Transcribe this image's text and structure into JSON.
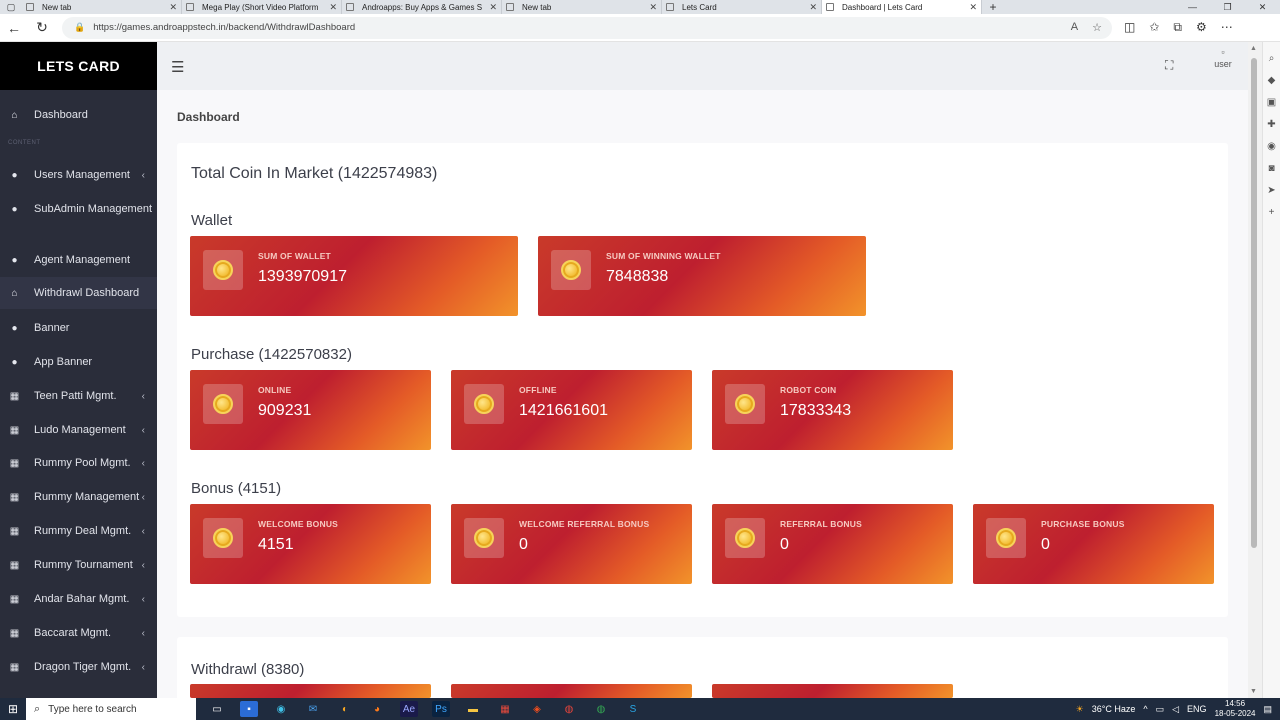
{
  "browser": {
    "tabs": [
      {
        "label": "New tab",
        "active": false
      },
      {
        "label": "Mega Play (Short Video Platform",
        "active": false
      },
      {
        "label": "Androapps: Buy Apps & Games S",
        "active": false
      },
      {
        "label": "New tab",
        "active": false
      },
      {
        "label": "Lets Card",
        "active": false
      },
      {
        "label": "Dashboard | Lets Card",
        "active": true
      }
    ],
    "url": "https://games.androappstech.in/backend/WithdrawlDashboard"
  },
  "sidebar": {
    "brand": "LETS CARD",
    "section_label": "CONTENT",
    "items": [
      {
        "label": "Dashboard",
        "icon": "home-icon",
        "has_chevron": false
      },
      {
        "label": "Users Management",
        "icon": "user-icon",
        "has_chevron": true
      },
      {
        "label": "SubAdmin Management",
        "icon": "user-icon",
        "has_chevron": false
      },
      {
        "label": "Agent Management",
        "icon": "user-icon",
        "has_chevron": false
      },
      {
        "label": "Withdrawl Dashboard",
        "icon": "home-icon",
        "has_chevron": false
      },
      {
        "label": "Banner",
        "icon": "user-icon",
        "has_chevron": false
      },
      {
        "label": "App Banner",
        "icon": "user-icon",
        "has_chevron": false
      },
      {
        "label": "Teen Patti Mgmt.",
        "icon": "grid-icon",
        "has_chevron": true
      },
      {
        "label": "Ludo Management",
        "icon": "grid-icon",
        "has_chevron": true
      },
      {
        "label": "Rummy Pool Mgmt.",
        "icon": "grid-icon",
        "has_chevron": true
      },
      {
        "label": "Rummy Management",
        "icon": "grid-icon",
        "has_chevron": true
      },
      {
        "label": "Rummy Deal Mgmt.",
        "icon": "grid-icon",
        "has_chevron": true
      },
      {
        "label": "Rummy Tournament",
        "icon": "grid-icon",
        "has_chevron": true
      },
      {
        "label": "Andar Bahar Mgmt.",
        "icon": "grid-icon",
        "has_chevron": true
      },
      {
        "label": "Baccarat Mgmt.",
        "icon": "grid-icon",
        "has_chevron": true
      },
      {
        "label": "Dragon Tiger Mgmt.",
        "icon": "grid-icon",
        "has_chevron": true
      }
    ]
  },
  "topbar": {
    "user_label": "user"
  },
  "main": {
    "breadcrumb": "Dashboard",
    "total_coin": "Total Coin In Market (1422574983)",
    "wallet": {
      "title": "Wallet",
      "cards": [
        {
          "label": "SUM OF WALLET",
          "value": "1393970917"
        },
        {
          "label": "SUM OF WINNING WALLET",
          "value": "7848838"
        }
      ]
    },
    "purchase": {
      "title": "Purchase (1422570832)",
      "cards": [
        {
          "label": "ONLINE",
          "value": "909231"
        },
        {
          "label": "OFFLINE",
          "value": "1421661601"
        },
        {
          "label": "ROBOT COIN",
          "value": "17833343"
        }
      ]
    },
    "bonus": {
      "title": "Bonus (4151)",
      "cards": [
        {
          "label": "WELCOME BONUS",
          "value": "4151"
        },
        {
          "label": "WELCOME REFERRAL BONUS",
          "value": "0"
        },
        {
          "label": "REFERRAL BONUS",
          "value": "0"
        },
        {
          "label": "PURCHASE BONUS",
          "value": "0"
        }
      ]
    },
    "withdrawl": {
      "title": "Withdrawl (8380)"
    }
  },
  "taskbar": {
    "search_placeholder": "Type here to search",
    "weather": "36°C  Haze",
    "lang": "ENG",
    "time": "14:56",
    "date": "18-05-2024"
  }
}
